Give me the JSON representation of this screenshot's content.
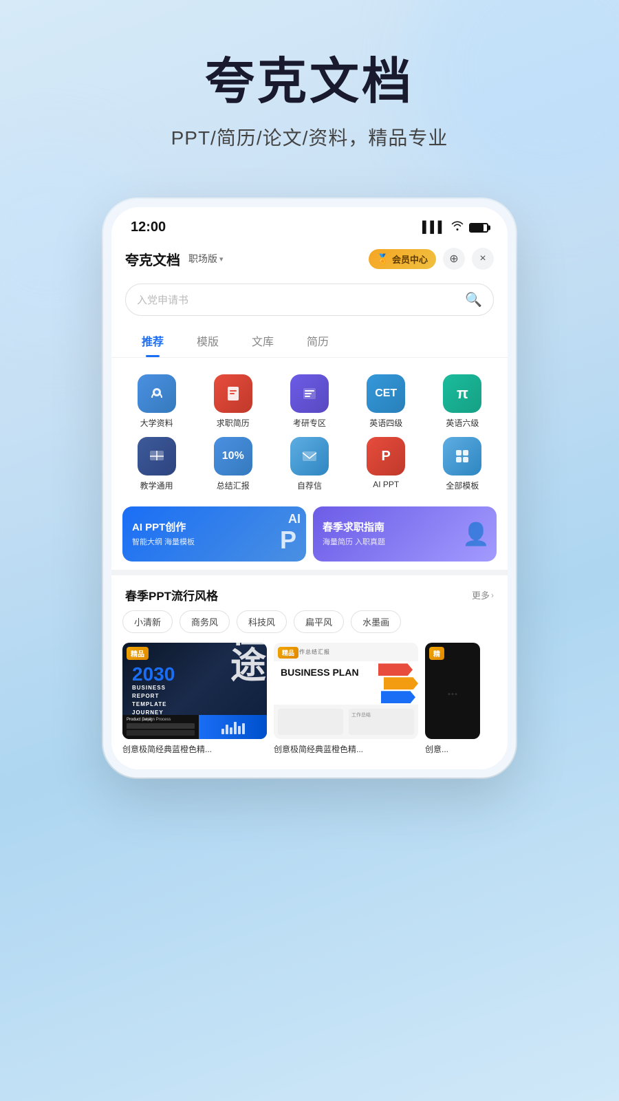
{
  "hero": {
    "title": "夸克文档",
    "subtitle": "PPT/简历/论文/资料，精品专业"
  },
  "status_bar": {
    "time": "12:00",
    "signal": "▌▌▌",
    "wifi": "WiFi",
    "battery": "battery"
  },
  "header": {
    "brand": "夸克文档",
    "edition": "职场版",
    "vip_label": "会员中心",
    "add_icon": "+",
    "close_icon": "×"
  },
  "search": {
    "placeholder": "入党申请书",
    "search_icon": "🔍"
  },
  "tabs": [
    {
      "label": "推荐",
      "active": true
    },
    {
      "label": "模版",
      "active": false
    },
    {
      "label": "文库",
      "active": false
    },
    {
      "label": "简历",
      "active": false
    }
  ],
  "grid_items": [
    {
      "icon": "🎓",
      "label": "大学资料",
      "color": "icon-blue"
    },
    {
      "icon": "📄",
      "label": "求职简历",
      "color": "icon-red"
    },
    {
      "icon": "📚",
      "label": "考研专区",
      "color": "icon-purple"
    },
    {
      "icon": "📝",
      "label": "英语四级",
      "color": "icon-cet"
    },
    {
      "icon": "π",
      "label": "英语六级",
      "color": "icon-pi"
    },
    {
      "icon": "📋",
      "label": "教学通用",
      "color": "icon-teach"
    },
    {
      "icon": "%",
      "label": "总结汇报",
      "color": "icon-sum"
    },
    {
      "icon": "✉",
      "label": "自荐信",
      "color": "icon-letter"
    },
    {
      "icon": "P",
      "label": "AI PPT",
      "color": "icon-ai"
    },
    {
      "icon": "⊞",
      "label": "全部模板",
      "color": "icon-all"
    }
  ],
  "banners": [
    {
      "title": "AI PPT创作",
      "subtitle": "智能大纲 海量模板",
      "color": "banner-blue",
      "icon": "P",
      "extra": "AI"
    },
    {
      "title": "春季求职指南",
      "subtitle": "海量简历 入职真题",
      "color": "banner-purple",
      "icon": "👤"
    }
  ],
  "section": {
    "title": "春季PPT流行风格",
    "more": "更多"
  },
  "style_tags": [
    "小清新",
    "商务风",
    "科技风",
    "扁平风",
    "水墨画"
  ],
  "templates": [
    {
      "label": "创意极简经典蓝橙色精...",
      "badge": "精品",
      "type": "2030"
    },
    {
      "label": "创意极简经典蓝橙色精...",
      "badge": "精品",
      "type": "bizplan"
    },
    {
      "label": "创意...",
      "badge": "精",
      "type": "dark"
    }
  ]
}
